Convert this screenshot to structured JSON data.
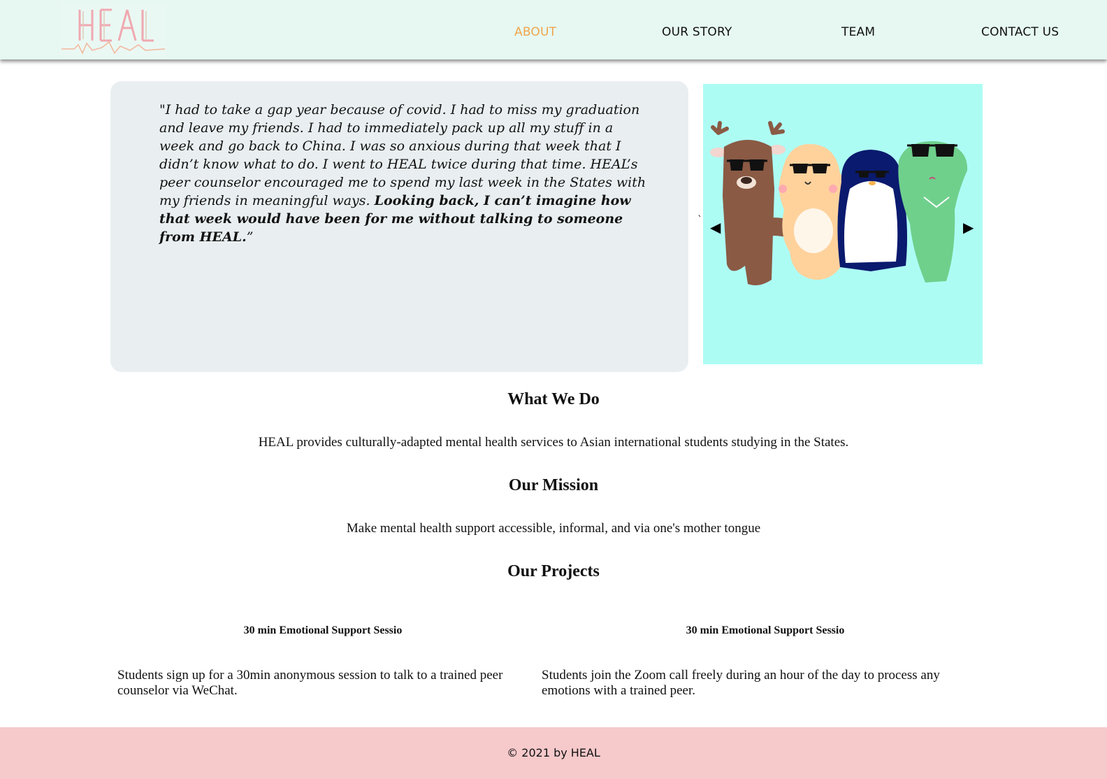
{
  "header": {
    "logo_text": "HEAL",
    "nav": [
      {
        "label": "ABOUT"
      },
      {
        "label": "OUR STORY"
      },
      {
        "label": "TEAM"
      },
      {
        "label": "CONTACT US"
      }
    ],
    "active_nav": "ABOUT",
    "active_color": "#f0a54e"
  },
  "quote": {
    "text": "\"I had to take a gap year because of covid. I had to miss my graduation and leave my friends. I had to immediately pack up all my stuff in a week and go back to China. I was so anxious during that week that I didn’t know what to do. I went to HEAL twice during that time. HEAL’s peer counselor encouraged me to spend my last week in the States with my friends in meaningful ways. ",
    "bold": "Looking back, I can’t imagine how that week would have been for me without talking to someone from HEAL.",
    "closing": "”"
  },
  "slideshow": {
    "prev_symbol": "◀",
    "next_symbol": "▶",
    "tick": "`"
  },
  "what_we_do": {
    "heading": "What We Do",
    "text": "HEAL provides culturally-adapted mental health services to Asian international students studying in the States."
  },
  "mission": {
    "heading": "Our Mission",
    "text": "Make mental health support accessible, informal, and via one's mother tongue"
  },
  "projects": {
    "heading": "Our Projects",
    "items": [
      {
        "title": "30 min Emotional Support Sessio",
        "description": "Students sign up for a 30min anonymous session to talk to a trained peer counselor via WeChat."
      },
      {
        "title": "30 min Emotional Support Sessio",
        "description": "Students join the Zoom call freely during an hour of the day to process any emotions with a trained peer."
      }
    ]
  },
  "footer": {
    "text": "© 2021 by HEAL"
  },
  "colors": {
    "header_bg": "#e6f8f1",
    "footer_bg": "#f6c9cb",
    "slideshow_bg": "#adfcf4",
    "quote_bg": "#e9eff1"
  }
}
